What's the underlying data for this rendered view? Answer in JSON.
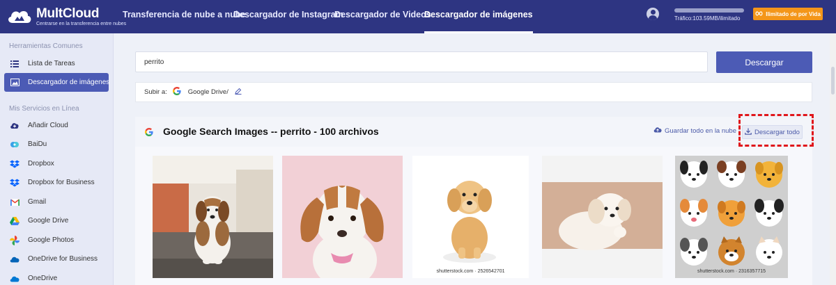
{
  "brand": {
    "title": "MultCloud",
    "subtitle": "Centrarse en la transferencia entre nubes"
  },
  "nav": {
    "items": [
      {
        "label": "Transferencia de nube a nube"
      },
      {
        "label": "Descargador de Instagram"
      },
      {
        "label": "Descargador de Videos"
      },
      {
        "label": "Descargador de imágenes"
      }
    ]
  },
  "account": {
    "traffic": "Tráfico:103.59MB/ilimitado",
    "plan_label": "Ilimitado de por Vida"
  },
  "sidebar": {
    "common_title": "Herramientas Comunes",
    "common_items": [
      {
        "label": "Lista de Tareas",
        "icon": "list-icon"
      },
      {
        "label": "Descargador de imágenes",
        "icon": "image-icon"
      }
    ],
    "services_title": "Mis Servicios en Línea",
    "services": [
      {
        "label": "Añadir Cloud",
        "icon": "add-cloud-icon"
      },
      {
        "label": "BaiDu",
        "icon": "baidu-icon"
      },
      {
        "label": "Dropbox",
        "icon": "dropbox-icon"
      },
      {
        "label": "Dropbox for Business",
        "icon": "dropbox-business-icon"
      },
      {
        "label": "Gmail",
        "icon": "gmail-icon"
      },
      {
        "label": "Google Drive",
        "icon": "google-drive-icon"
      },
      {
        "label": "Google Photos",
        "icon": "google-photos-icon"
      },
      {
        "label": "OneDrive for Business",
        "icon": "onedrive-business-icon"
      },
      {
        "label": "OneDrive",
        "icon": "onedrive-icon"
      }
    ]
  },
  "search": {
    "value": "perrito",
    "button_label": "Descargar"
  },
  "destination": {
    "label": "Subir a:",
    "path": "Google Drive/"
  },
  "results": {
    "title": "Google Search Images -- perrito - 100 archivos",
    "save_all_label": "Guardar todo en la nube",
    "download_all_label": "Descargar todo",
    "images": [
      {
        "caption": ""
      },
      {
        "caption": ""
      },
      {
        "caption": "shutterstock.com · 2526542701"
      },
      {
        "caption": ""
      },
      {
        "caption": "shutterstock.com · 2316357715"
      }
    ]
  },
  "colors": {
    "nav_bg": "#2e3582",
    "accent": "#4c5bb5",
    "plan_orange": "#f49619",
    "highlight_red": "#e0161b"
  }
}
